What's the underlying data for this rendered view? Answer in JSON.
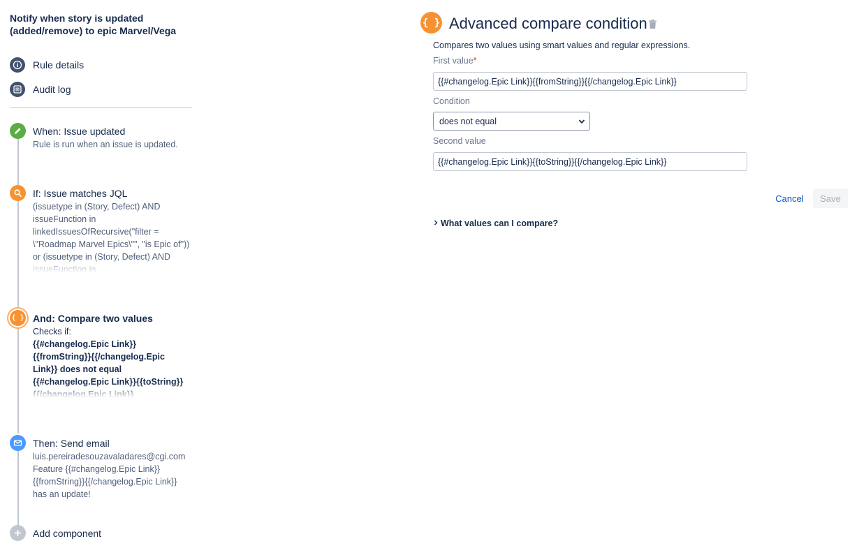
{
  "rule": {
    "title": "Notify when story is updated (added/remove) to epic Marvel/Vega"
  },
  "nav": {
    "rule_details": "Rule details",
    "audit_log": "Audit log"
  },
  "steps": [
    {
      "title": "When: Issue updated",
      "lines": [
        "Rule is run when an issue is updated."
      ],
      "icon": "pencil-icon",
      "color": "#5aac44"
    },
    {
      "title": "If: Issue matches JQL",
      "lines": [
        "(issuetype in (Story, Defect) AND",
        "issueFunction in",
        "linkedIssuesOfRecursive(\"filter =",
        "\\\"Roadmap Marvel Epics\\\"\", \"is Epic of\"))",
        "or (issuetype in (Story, Defect) AND",
        "issueFunction in"
      ],
      "icon": "search-icon",
      "color": "#f79232"
    },
    {
      "title": "And: Compare two values",
      "lines": [
        "Checks if:",
        "{{#changelog.Epic Link}}",
        "{{fromString}}{{/changelog.Epic",
        "Link}} does not equal",
        "{{#changelog.Epic Link}}{{toString}}",
        "{{/changelog.Epic Link}}"
      ],
      "icon": "braces-icon",
      "icon_glyph": "{ }",
      "color": "#f79232"
    },
    {
      "title": "Then: Send email",
      "lines": [
        "luis.pereiradesouzavaladares@cgi.com",
        "Feature {{#changelog.Epic Link}}",
        "{{fromString}}{{/changelog.Epic Link}}",
        "has an update!"
      ],
      "icon": "envelope-icon",
      "color": "#4c9aff"
    }
  ],
  "add_component": "Add component",
  "panel": {
    "icon_glyph": "{ }",
    "title": "Advanced compare condition",
    "intro": "Compares two values using smart values and regular expressions.",
    "first_value_label": "First value",
    "required_mark": "*",
    "first_value": "{{#changelog.Epic Link}}{{fromString}}{{/changelog.Epic Link}}",
    "condition_label": "Condition",
    "condition_value": "does not equal",
    "second_value_label": "Second value",
    "second_value": "{{#changelog.Epic Link}}{{toString}}{{/changelog.Epic Link}}",
    "cancel": "Cancel",
    "save": "Save",
    "expand_label": "What values can I compare?"
  },
  "colors": {
    "accent": "#f79232",
    "link": "#0052cc",
    "success": "#5aac44",
    "info": "#4c9aff"
  }
}
